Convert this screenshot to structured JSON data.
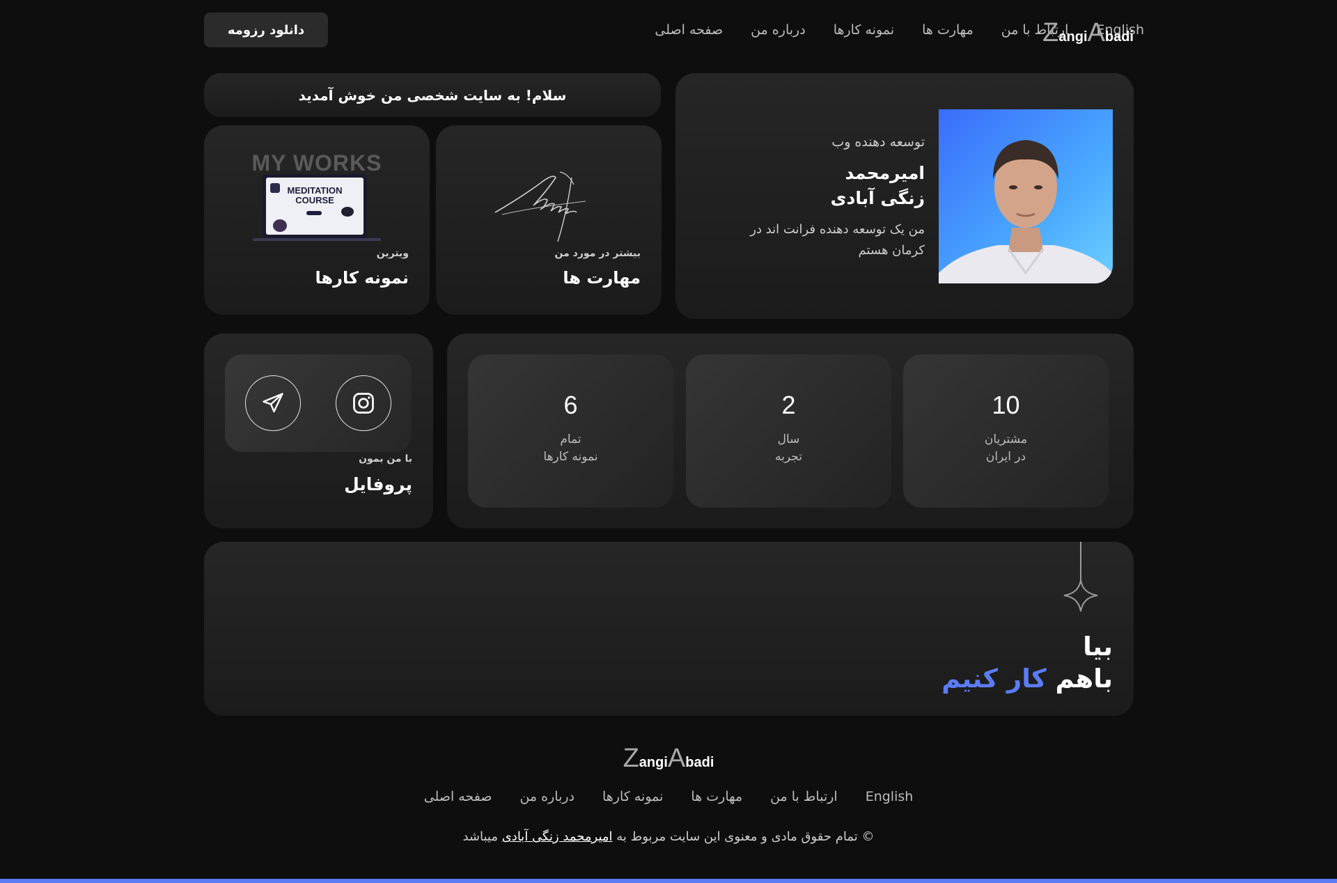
{
  "logo": {
    "z": "Z",
    "angi": "angi",
    "a": "A",
    "badi": "badi"
  },
  "nav": {
    "items": [
      "صفحه اصلی",
      "درباره من",
      "نمونه کارها",
      "مهارت ها",
      "ارتباط با من",
      "English"
    ],
    "resume_label": "دانلود رزومه"
  },
  "welcome": "سلام! به سایت شخصی من خوش آمدید",
  "profile": {
    "role": "توسعه دهنده وب",
    "name_line1": "امیرمحمد",
    "name_line2": "زنگی آبادی",
    "bio": "من یک توسعه دهنده فرانت اند در کرمان هستم"
  },
  "skills_card": {
    "subtitle": "بیشتر در مورد من",
    "title": "مهارت ها"
  },
  "works_card": {
    "subtitle": "ویترین",
    "title": "نمونه کارها",
    "banner": "MY WORKS",
    "screen_title": "MEDITATION COURSE"
  },
  "stats": [
    {
      "value": "10",
      "line1": "مشتریان",
      "line2": "در ایران"
    },
    {
      "value": "2",
      "line1": "سال",
      "line2": "تجربه"
    },
    {
      "value": "6",
      "line1": "تمام",
      "line2": "نمونه کارها"
    }
  ],
  "profile_card": {
    "subtitle": "با من بمون",
    "title": "پروفایل"
  },
  "cta": {
    "line1": "بیا",
    "line2_plain": "باهم",
    "line2_accent": "کار کنیم"
  },
  "footer": {
    "links": [
      "صفحه اصلی",
      "درباره من",
      "نمونه کارها",
      "مهارت ها",
      "ارتباط با من",
      "English"
    ],
    "copyright_prefix": "© تمام حقوق مادی و معنوی این سایت مربوط به",
    "copyright_name": "امیرمحمد زنگی آبادی",
    "copyright_suffix": "میباشد"
  },
  "colors": {
    "background": "#0e0e0e",
    "card": "#222222",
    "accent": "#5c7cf5"
  },
  "icons": [
    "instagram-icon",
    "telegram-icon",
    "sparkle-star-icon",
    "signature-icon"
  ]
}
